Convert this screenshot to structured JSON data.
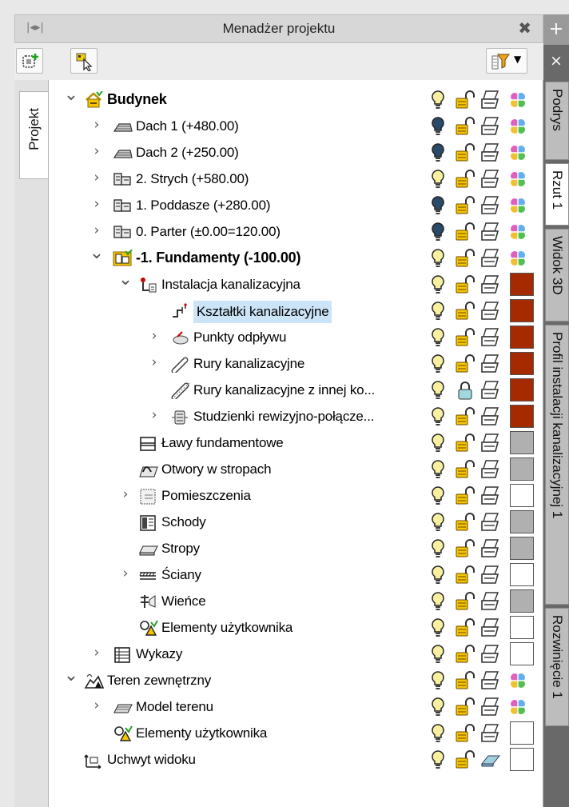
{
  "titlebar": {
    "title": "Menadżer projektu",
    "grip_icon": "dock-grip-icon",
    "close_symbol": "✖"
  },
  "toolbar": {
    "add_icon": "add-layer-icon",
    "select_icon": "select-arrow-icon",
    "filter_icon": "filter-dropdown-icon",
    "dropdown_symbol": "▼"
  },
  "left_tabs": [
    {
      "label": "Projekt",
      "active": true
    }
  ],
  "right_dock": {
    "plus_symbol": "+",
    "close_symbol": "×",
    "tabs": [
      {
        "label": "Podrys",
        "active": false
      },
      {
        "label": "Rzut 1",
        "active": true
      },
      {
        "label": "Widok 3D",
        "active": false
      },
      {
        "label": "Profil instalacji kanalizacyjnej 1",
        "active": false
      },
      {
        "label": "Rozwinięcie 1",
        "active": false
      }
    ]
  },
  "colors": {
    "sewer": "#a52a00",
    "gray": "#b0b0b0",
    "white": "#ffffff",
    "selection": "#cce4f7",
    "folder_yellow": "#f5c400"
  },
  "tree": [
    {
      "label": "Budynek",
      "level": 0,
      "expander": "open",
      "icon": "building-icon",
      "bold": true,
      "bulb": "on",
      "lock": "open",
      "print": "print",
      "color": "multi"
    },
    {
      "label": "Dach 1 (+480.00)",
      "level": 1,
      "expander": "closed",
      "icon": "roof-icon",
      "bulb": "dark",
      "lock": "open",
      "print": "print",
      "color": "multi"
    },
    {
      "label": "Dach 2 (+250.00)",
      "level": 1,
      "expander": "closed",
      "icon": "roof-icon",
      "bulb": "dark",
      "lock": "open",
      "print": "print",
      "color": "multi"
    },
    {
      "label": "2. Strych (+580.00)",
      "level": 1,
      "expander": "closed",
      "icon": "storey-icon",
      "bulb": "on",
      "lock": "open",
      "print": "print",
      "color": "multi"
    },
    {
      "label": "1. Poddasze (+280.00)",
      "level": 1,
      "expander": "closed",
      "icon": "storey-icon",
      "bulb": "dark",
      "lock": "open",
      "print": "print",
      "color": "multi"
    },
    {
      "label": "0. Parter (±0.00=120.00)",
      "level": 1,
      "expander": "closed",
      "icon": "storey-icon",
      "bulb": "dark",
      "lock": "open",
      "print": "print",
      "color": "multi"
    },
    {
      "label": "-1. Fundamenty (-100.00)",
      "level": 1,
      "expander": "open",
      "icon": "active-storey-icon",
      "bold": true,
      "bulb": "on",
      "lock": "open",
      "print": "print",
      "color": "multi"
    },
    {
      "label": "Instalacja kanalizacyjna",
      "level": 2,
      "expander": "open",
      "icon": "sewer-installation-icon",
      "bulb": "on",
      "lock": "open",
      "print": "print",
      "color": "sewer"
    },
    {
      "label": "Kształtki kanalizacyjne",
      "level": 3,
      "expander": "none",
      "icon": "pipe-fitting-icon",
      "selected": true,
      "bulb": "on",
      "lock": "open",
      "print": "print",
      "color": "sewer"
    },
    {
      "label": "Punkty odpływu",
      "level": 3,
      "expander": "closed",
      "icon": "drain-point-icon",
      "bulb": "on",
      "lock": "open",
      "print": "print",
      "color": "sewer"
    },
    {
      "label": "Rury kanalizacyjne",
      "level": 3,
      "expander": "closed",
      "icon": "pipe-icon",
      "bulb": "on",
      "lock": "open",
      "print": "print",
      "color": "sewer"
    },
    {
      "label": "Rury kanalizacyjne z innej ko...",
      "level": 3,
      "expander": "none",
      "icon": "pipe-external-icon",
      "bulb": "on",
      "lock": "closed",
      "print": "print",
      "color": "sewer"
    },
    {
      "label": "Studzienki rewizyjno-połącze...",
      "level": 3,
      "expander": "closed",
      "icon": "manhole-icon",
      "bulb": "on",
      "lock": "open",
      "print": "print",
      "color": "sewer"
    },
    {
      "label": "Ławy fundamentowe",
      "level": 2,
      "expander": "none",
      "icon": "footing-icon",
      "bulb": "on",
      "lock": "open",
      "print": "print",
      "color": "gray"
    },
    {
      "label": "Otwory w stropach",
      "level": 2,
      "expander": "none",
      "icon": "slab-opening-icon",
      "bulb": "on",
      "lock": "open",
      "print": "print",
      "color": "gray"
    },
    {
      "label": "Pomieszczenia",
      "level": 2,
      "expander": "closed",
      "icon": "room-icon",
      "bulb": "on",
      "lock": "open",
      "print": "print",
      "color": "white"
    },
    {
      "label": "Schody",
      "level": 2,
      "expander": "none",
      "icon": "stairs-icon",
      "bulb": "on",
      "lock": "open",
      "print": "print",
      "color": "gray"
    },
    {
      "label": "Stropy",
      "level": 2,
      "expander": "none",
      "icon": "slab-icon",
      "bulb": "on",
      "lock": "open",
      "print": "print",
      "color": "gray"
    },
    {
      "label": "Ściany",
      "level": 2,
      "expander": "closed",
      "icon": "wall-icon",
      "bulb": "on",
      "lock": "open",
      "print": "print",
      "color": "white"
    },
    {
      "label": "Wieńce",
      "level": 2,
      "expander": "none",
      "icon": "ring-beam-icon",
      "bulb": "on",
      "lock": "open",
      "print": "print",
      "color": "gray"
    },
    {
      "label": "Elementy użytkownika",
      "level": 2,
      "expander": "none",
      "icon": "user-elements-icon",
      "bulb": "on",
      "lock": "open",
      "print": "print",
      "color": "white"
    },
    {
      "label": "Wykazy",
      "level": 1,
      "expander": "closed",
      "icon": "list-icon",
      "bulb": "on",
      "lock": "open",
      "print": "print",
      "color": "white"
    },
    {
      "label": "Teren zewnętrzny",
      "level": 0,
      "expander": "open",
      "icon": "terrain-icon",
      "bulb": "on",
      "lock": "open",
      "print": "print",
      "color": "multi"
    },
    {
      "label": "Model terenu",
      "level": 1,
      "expander": "closed",
      "icon": "terrain-model-icon",
      "bulb": "on",
      "lock": "open",
      "print": "print",
      "color": "multi"
    },
    {
      "label": "Elementy użytkownika",
      "level": 1,
      "expander": "none",
      "icon": "user-elements-icon",
      "bulb": "on",
      "lock": "open",
      "print": "print",
      "color": "white"
    },
    {
      "label": "Uchwyt widoku",
      "level": 0,
      "expander": "none",
      "icon": "view-handle-icon",
      "bulb": "on",
      "lock": "open",
      "print": "eraser",
      "color": "white"
    }
  ]
}
